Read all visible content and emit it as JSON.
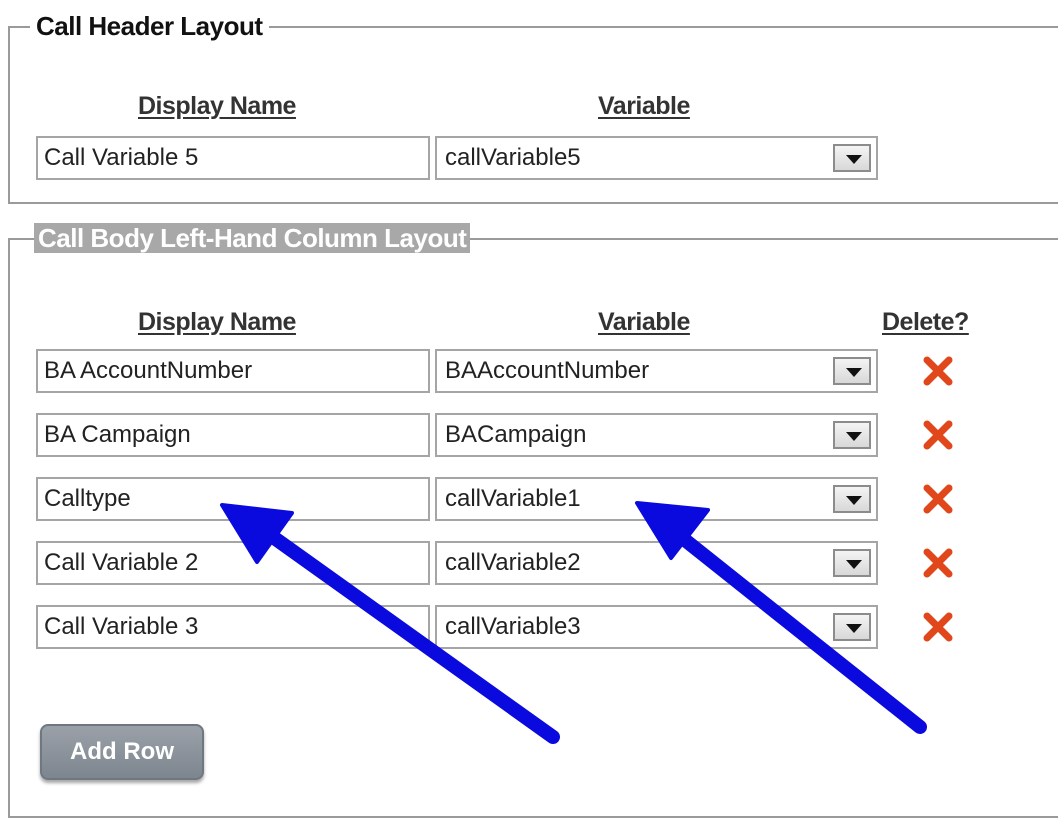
{
  "header_section": {
    "legend": "Call Header Layout",
    "col_display_name": "Display Name",
    "col_variable": "Variable",
    "row": {
      "display_name": "Call Variable 5",
      "variable": "callVariable5"
    }
  },
  "body_section": {
    "legend": "Call Body Left-Hand Column Layout",
    "col_display_name": "Display Name",
    "col_variable": "Variable",
    "col_delete": "Delete?",
    "rows": [
      {
        "display_name": "BA AccountNumber",
        "variable": "BAAccountNumber"
      },
      {
        "display_name": "BA Campaign",
        "variable": "BACampaign"
      },
      {
        "display_name": "Calltype",
        "variable": "callVariable1"
      },
      {
        "display_name": "Call Variable 2",
        "variable": "callVariable2"
      },
      {
        "display_name": "Call Variable 3",
        "variable": "callVariable3"
      }
    ],
    "add_row_label": "Add Row"
  },
  "icons": {
    "dropdown": "chevron-down-icon",
    "delete": "close-icon",
    "annotation": "arrow-annotation-icon"
  },
  "colors": {
    "delete_x": "#e0471a",
    "annotation_arrow": "#0a0adf",
    "button_bg": "#8a929b"
  }
}
